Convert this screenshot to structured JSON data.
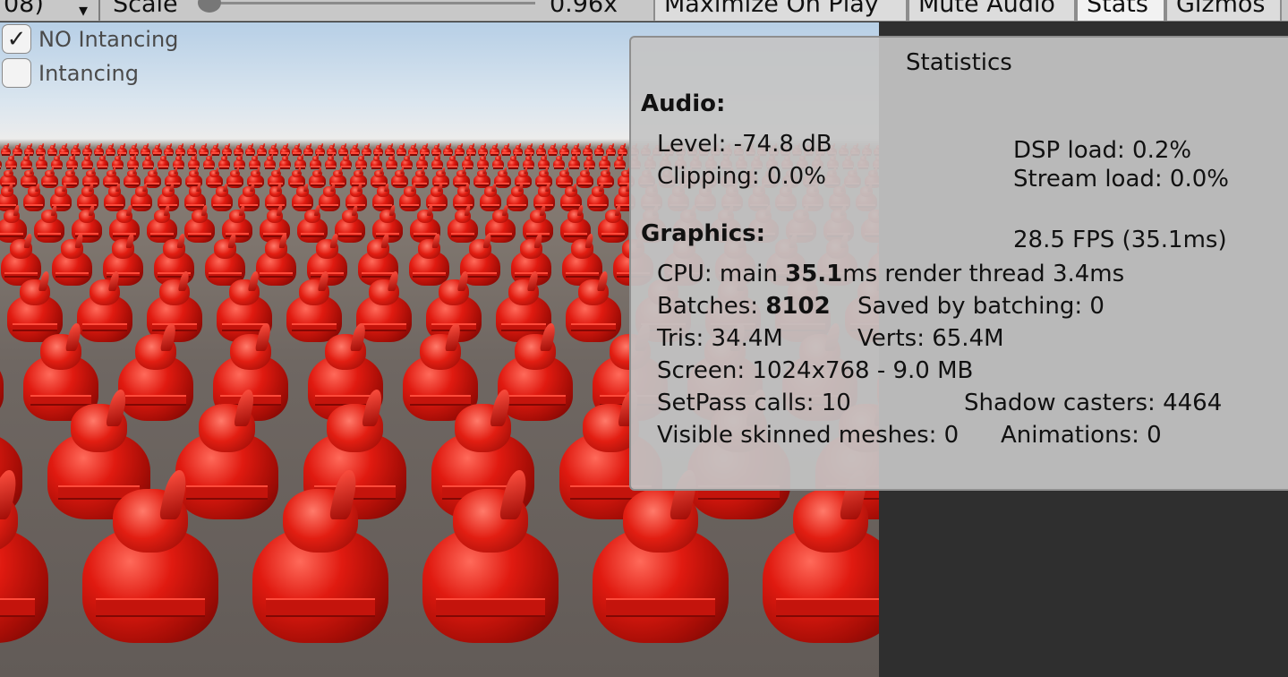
{
  "toolbar": {
    "left_fragment": "08)",
    "scale_label": "Scale",
    "scale_value": "0.96x",
    "maximize_on_play": "Maximize On Play",
    "mute_audio": "Mute Audio",
    "stats": "Stats",
    "gizmos": "Gizmos"
  },
  "toggles": [
    {
      "label": "NO Intancing",
      "checked": true
    },
    {
      "label": "Intancing",
      "checked": false
    }
  ],
  "stats": {
    "title": "Statistics",
    "audio_heading": "Audio:",
    "level": "Level: -74.8 dB",
    "clipping": "Clipping: 0.0%",
    "dsp_load": "DSP load: 0.2%",
    "stream_load": "Stream load: 0.0%",
    "graphics_heading": "Graphics:",
    "fps": "28.5 FPS (35.1ms)",
    "cpu_prefix": "CPU: main ",
    "cpu_main": "35.1",
    "cpu_suffix": "ms  render thread 3.4ms",
    "batches_prefix": "Batches: ",
    "batches": "8102",
    "saved_by_batching": "Saved by batching: 0",
    "tris": "Tris: 34.4M",
    "verts": "Verts: 65.4M",
    "screen": "Screen: 1024x768 - 9.0 MB",
    "setpass": "SetPass calls: 10",
    "shadow_casters": "Shadow casters: 4464",
    "skinned_meshes": "Visible skinned meshes: 0",
    "animations": "Animations: 0"
  },
  "colors": {
    "unit_red": "#e01a10",
    "ground": "#6f6762",
    "sky": "#b7cfe6",
    "panel": "#c4c4c4"
  }
}
